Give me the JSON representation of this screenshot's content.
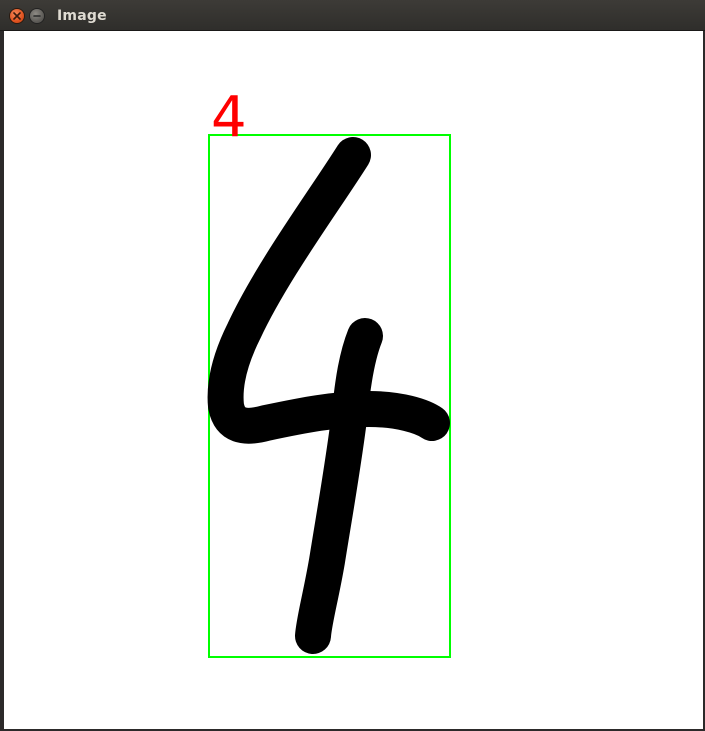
{
  "window": {
    "title": "Image"
  },
  "titlebar": {
    "close_icon": "close-icon",
    "minimize_icon": "minimize-icon"
  },
  "detection": {
    "label": "4",
    "label_color": "#ff0000",
    "box_color": "#00ff00",
    "stroke_color": "#000000"
  }
}
